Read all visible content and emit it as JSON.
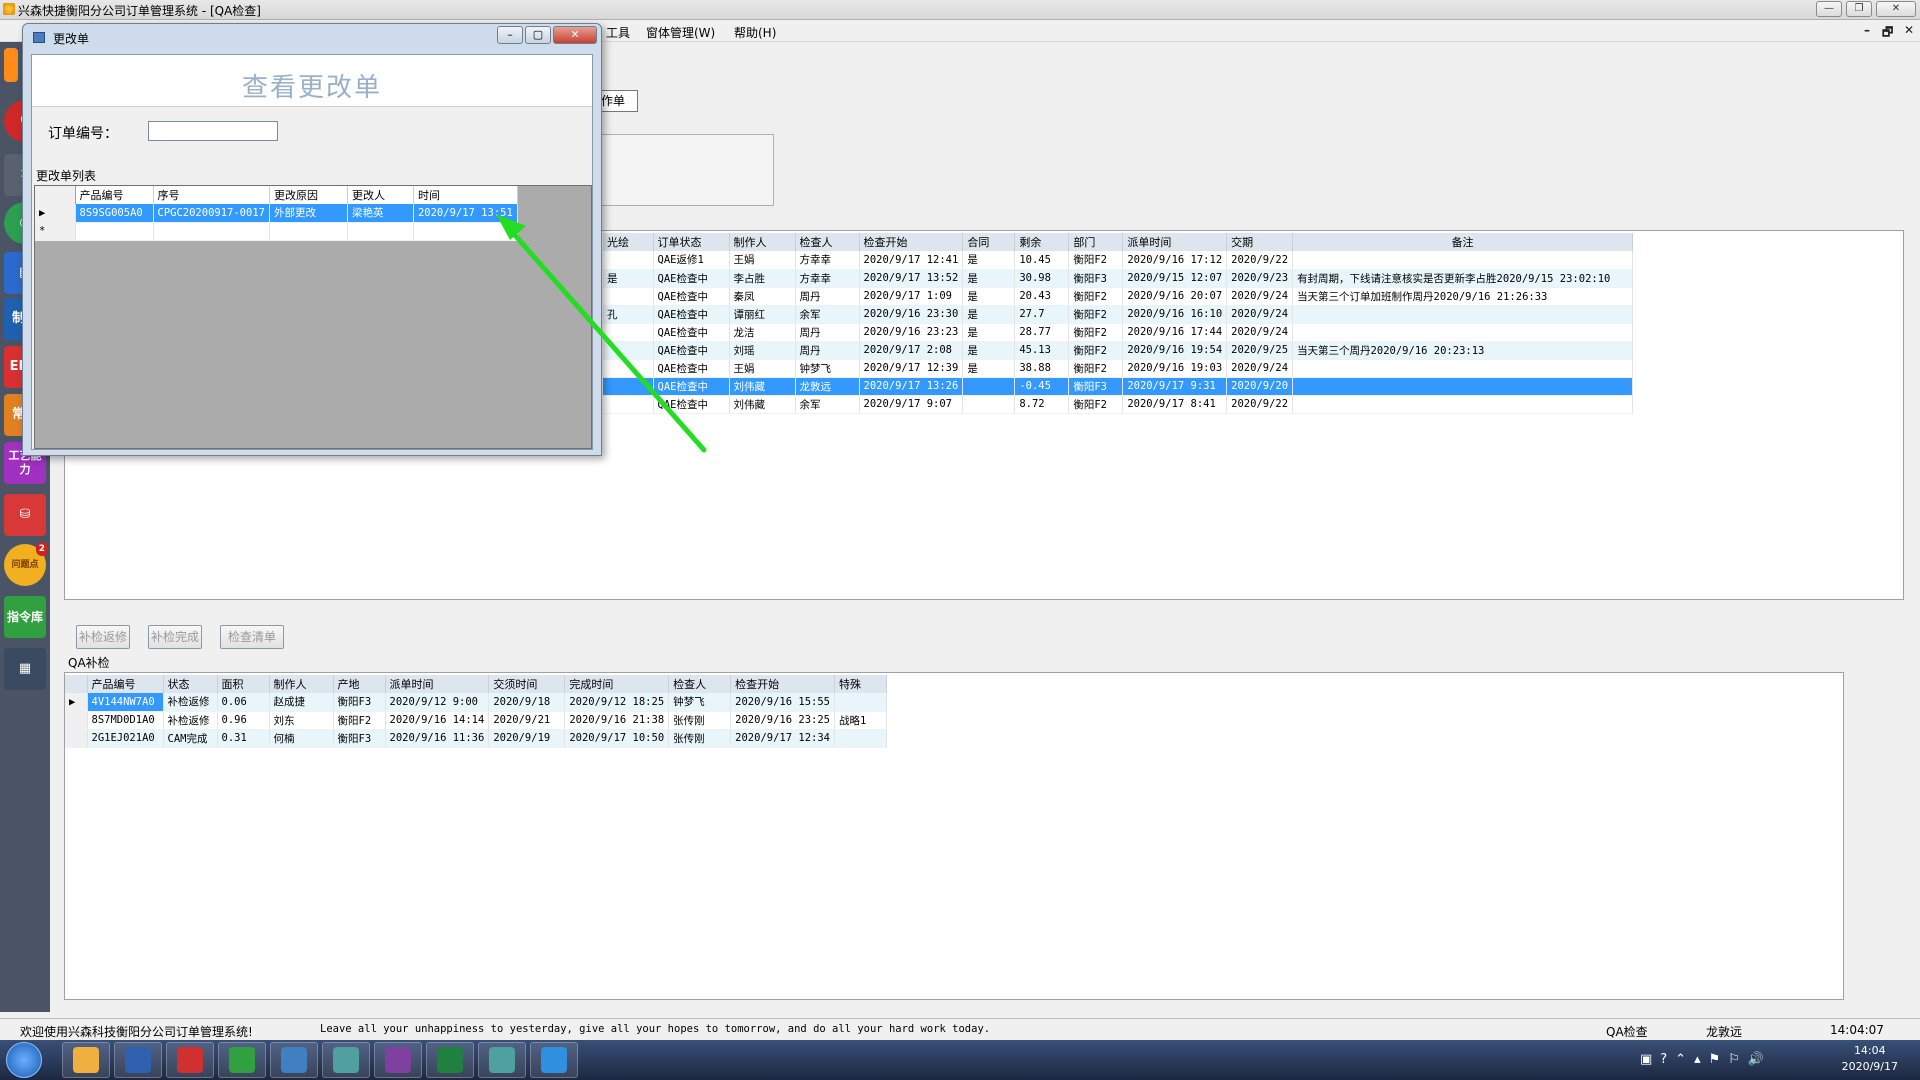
{
  "window": {
    "title": "兴森快捷衡阳分公司订单管理系统 - [QA检查]",
    "controls": [
      "—",
      "❐",
      "✕"
    ]
  },
  "menu": {
    "items": [
      "工具",
      "窗体管理(W)",
      "帮助(H)"
    ],
    "mdi_controls": [
      "–",
      "🗗",
      "✕"
    ]
  },
  "left_toolbar": {
    "items": [
      {
        "label": "",
        "icon": "orange-tool-icon",
        "color": "#ff8c1a"
      },
      {
        "label": "",
        "icon": "red-c-icon",
        "color": "#d02828"
      },
      {
        "label": "",
        "icon": "wrench-icon",
        "color": "#5a6270"
      },
      {
        "label": "",
        "icon": "green-chart-icon",
        "color": "#2aa050"
      },
      {
        "label": "",
        "icon": "blue-doc-icon",
        "color": "#2a6acc"
      },
      {
        "label": "制规",
        "icon": "rule-icon",
        "color": "#2060b0"
      },
      {
        "label": "EF规",
        "icon": "ef-rule-icon",
        "color": "#d83030"
      },
      {
        "label": "常问",
        "icon": "faq-icon",
        "color": "#e08020"
      },
      {
        "label": "工艺能力",
        "icon": "process-icon",
        "color": "#a030c0"
      },
      {
        "label": "",
        "icon": "database-icon",
        "color": "#d83838"
      },
      {
        "label": "问题点",
        "icon": "issue-icon",
        "color": "#f0b020"
      },
      {
        "label": "指令库",
        "icon": "command-icon",
        "color": "#30a040"
      },
      {
        "label": "",
        "icon": "calendar-icon",
        "color": "#5080c0"
      }
    ],
    "issue_badge": "2"
  },
  "main": {
    "tab_label": "作单",
    "orders_table": {
      "columns": [
        "光绘",
        "订单状态",
        "制作人",
        "检查人",
        "检查开始",
        "合同",
        "剩余",
        "部门",
        "派单时间",
        "交期",
        "备注"
      ],
      "rows": [
        [
          "",
          "QAE返修1",
          "王娟",
          "方幸幸",
          "2020/9/17 12:41",
          "是",
          "10.45",
          "衡阳F2",
          "2020/9/16 17:12",
          "2020/9/22",
          ""
        ],
        [
          "是",
          "QAE检查中",
          "李占胜",
          "方幸幸",
          "2020/9/17 13:52",
          "是",
          "30.98",
          "衡阳F3",
          "2020/9/15 12:07",
          "2020/9/23",
          "有封周期，下线请注意核实是否更新李占胜2020/9/15 23:02:10"
        ],
        [
          "",
          "QAE检查中",
          "秦凤",
          "周丹",
          "2020/9/17 1:09",
          "是",
          "20.43",
          "衡阳F2",
          "2020/9/16 20:07",
          "2020/9/24",
          "当天第三个订单加班制作周丹2020/9/16 21:26:33"
        ],
        [
          "孔",
          "QAE检查中",
          "谭丽红",
          "余军",
          "2020/9/16 23:30",
          "是",
          "27.7",
          "衡阳F2",
          "2020/9/16 16:10",
          "2020/9/24",
          ""
        ],
        [
          "",
          "QAE检查中",
          "龙洁",
          "周丹",
          "2020/9/16 23:23",
          "是",
          "28.77",
          "衡阳F2",
          "2020/9/16 17:44",
          "2020/9/24",
          ""
        ],
        [
          "",
          "QAE检查中",
          "刘瑶",
          "周丹",
          "2020/9/17 2:08",
          "是",
          "45.13",
          "衡阳F2",
          "2020/9/16 19:54",
          "2020/9/25",
          "当天第三个周丹2020/9/16 20:23:13"
        ],
        [
          "",
          "QAE检查中",
          "王娟",
          "钟梦飞",
          "2020/9/17 12:39",
          "是",
          "38.88",
          "衡阳F2",
          "2020/9/16 19:03",
          "2020/9/24",
          ""
        ],
        [
          "",
          "QAE检查中",
          "刘伟藏",
          "龙敦远",
          "2020/9/17 13:26",
          "",
          "-0.45",
          "衡阳F3",
          "2020/9/17 9:31",
          "2020/9/20",
          ""
        ],
        [
          "",
          "QAE检查中",
          "刘伟藏",
          "余军",
          "2020/9/17 9:07",
          "",
          "8.72",
          "衡阳F2",
          "2020/9/17 8:41",
          "2020/9/22",
          ""
        ]
      ]
    },
    "buttons": [
      "补检返修",
      "补检完成",
      "检查清单"
    ],
    "qa_section_label": "QA补检",
    "qa_table": {
      "columns": [
        "产品编号",
        "状态",
        "面积",
        "制作人",
        "产地",
        "派单时间",
        "交须时间",
        "完成时间",
        "检查人",
        "检查开始",
        "特殊"
      ],
      "rows": [
        [
          "4V144NW7A0",
          "补检返修",
          "0.06",
          "赵成捷",
          "衡阳F3",
          "2020/9/12 9:00",
          "2020/9/18",
          "2020/9/12 18:25",
          "钟梦飞",
          "2020/9/16 15:55",
          ""
        ],
        [
          "8S7MD0D1A0",
          "补检返修",
          "0.96",
          "刘东",
          "衡阳F2",
          "2020/9/16 14:14",
          "2020/9/21",
          "2020/9/16 21:38",
          "张传刚",
          "2020/9/16 23:25",
          "战略1"
        ],
        [
          "2G1EJ021A0",
          "CAM完成",
          "0.31",
          "何楠",
          "衡阳F3",
          "2020/9/16 11:36",
          "2020/9/19",
          "2020/9/17 10:50",
          "张传刚",
          "2020/9/17 12:34",
          ""
        ]
      ]
    }
  },
  "dialog": {
    "title": "更改单",
    "header": "查看更改单",
    "order_label": "订单编号：",
    "order_value": "",
    "list_label": "更改单列表",
    "grid": {
      "columns": [
        "产品编号",
        "序号",
        "更改原因",
        "更改人",
        "时间"
      ],
      "rows": [
        [
          "8S9SG005A0",
          "CPGC20200917-0017",
          "外部更改",
          "梁艳英",
          "2020/9/17 13:51"
        ]
      ],
      "new_row_marker": "*"
    }
  },
  "status": {
    "welcome": "欢迎使用兴森科技衡阳分公司订单管理系统!",
    "motto": "Leave all your unhappiness to yesterday, give all your hopes to tomorrow, and do all your hard work today.",
    "module": "QA检查",
    "user": "龙敦远",
    "time": "14:04:07"
  },
  "taskbar": {
    "apps": [
      {
        "icon": "paint-icon",
        "color": "#f0b040"
      },
      {
        "icon": "save-icon",
        "color": "#3060b0"
      },
      {
        "icon": "red-app-icon",
        "color": "#d03030"
      },
      {
        "icon": "green-p-icon",
        "color": "#30a040"
      },
      {
        "icon": "notepad-icon",
        "color": "#4080c0"
      },
      {
        "icon": "eye-icon",
        "color": "#50a0a0"
      },
      {
        "icon": "x-app-icon",
        "color": "#8040a0"
      },
      {
        "icon": "excel-icon",
        "color": "#208040"
      },
      {
        "icon": "camera-icon",
        "color": "#50a0a0"
      },
      {
        "icon": "feather-icon",
        "color": "#3090e0"
      }
    ],
    "clock_time": "14:04",
    "clock_date": "2020/9/17"
  },
  "colors": {
    "selection": "#3399ff",
    "grid_header": "#dde6ee",
    "alt_row": "#e8f6fb",
    "annotation_arrow": "#22dd22"
  }
}
